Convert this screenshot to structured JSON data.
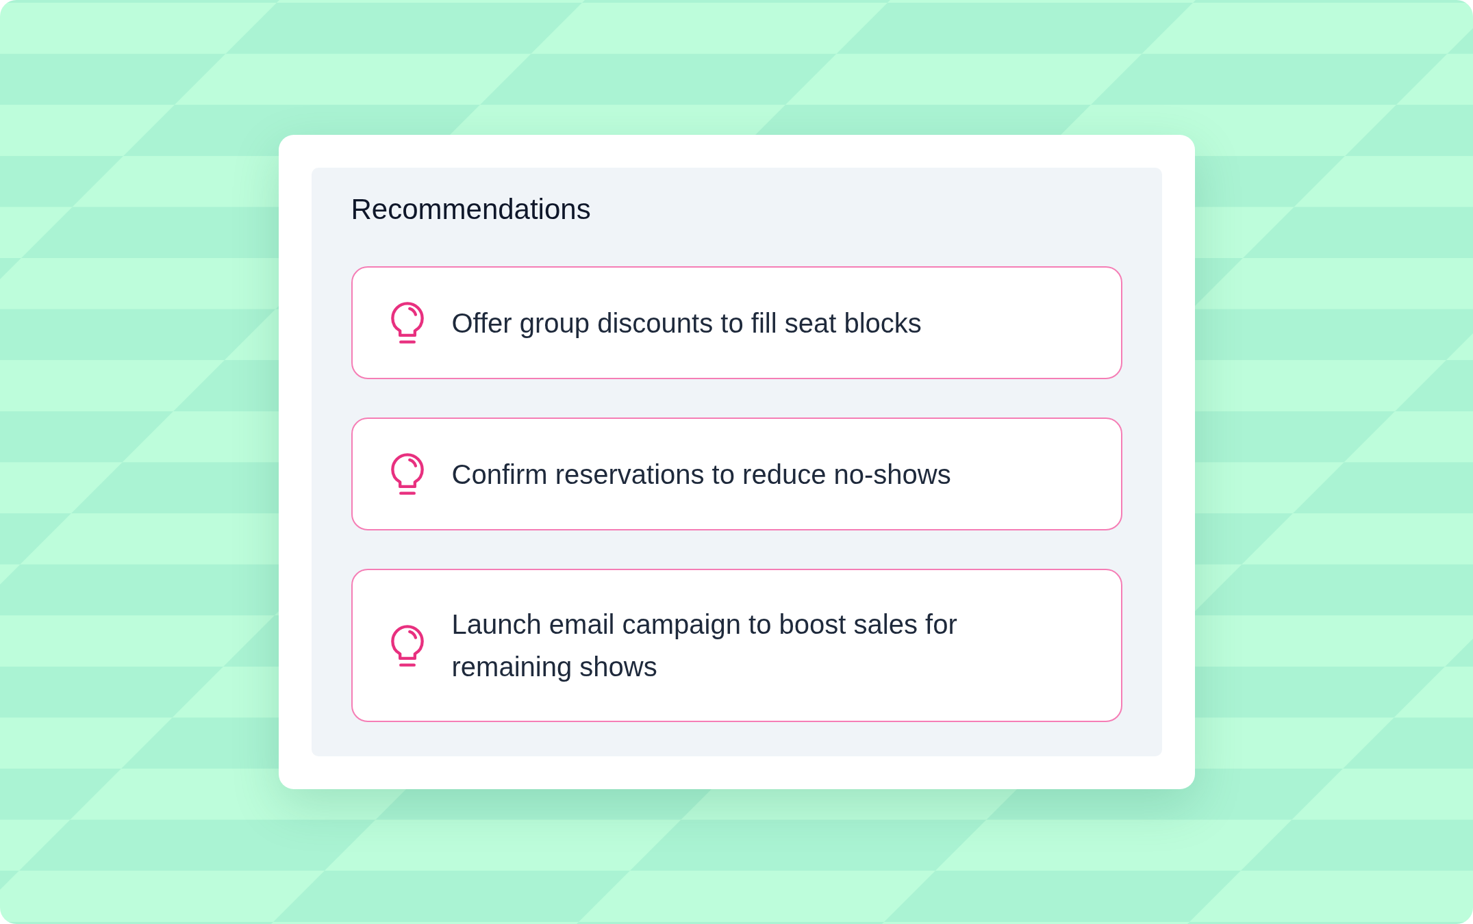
{
  "panel": {
    "title": "Recommendations",
    "items": [
      {
        "text": "Offer group discounts to fill seat blocks"
      },
      {
        "text": "Confirm reservations to reduce no-shows"
      },
      {
        "text": "Launch email campaign to boost sales for remaining shows"
      }
    ]
  }
}
